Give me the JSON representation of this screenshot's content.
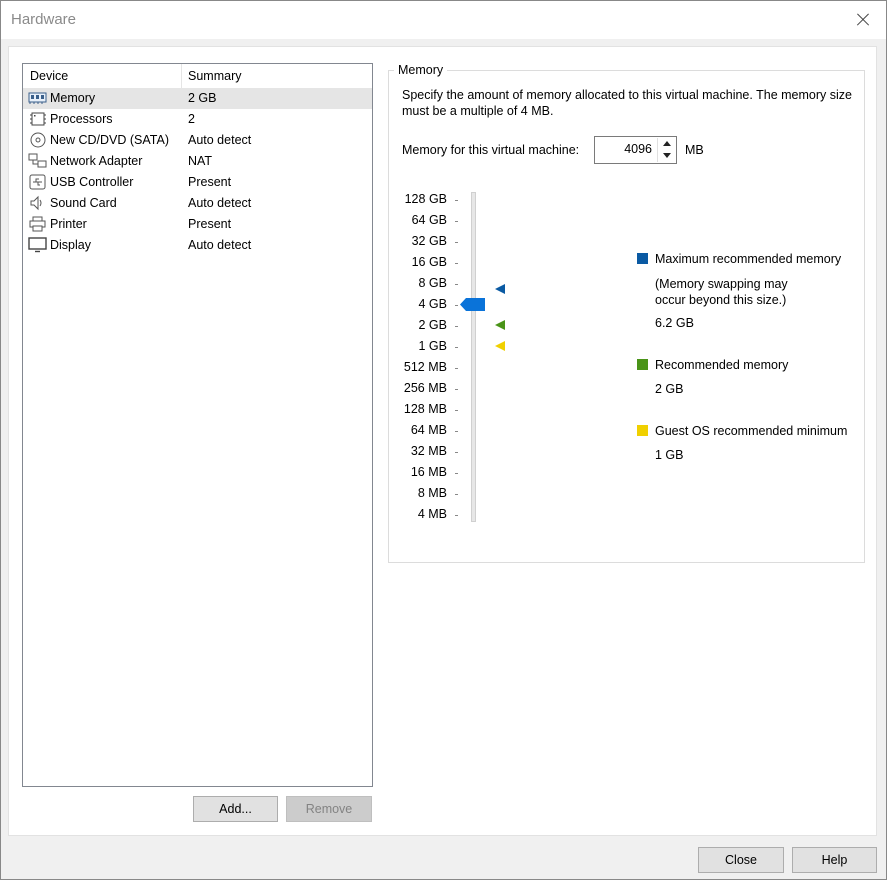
{
  "window": {
    "title": "Hardware"
  },
  "device_list": {
    "columns": {
      "device": "Device",
      "summary": "Summary"
    },
    "items": [
      {
        "name": "Memory",
        "summary": "2 GB",
        "icon": "memory-icon",
        "selected": true
      },
      {
        "name": "Processors",
        "summary": "2",
        "icon": "processor-icon"
      },
      {
        "name": "New CD/DVD (SATA)",
        "summary": "Auto detect",
        "icon": "cd-dvd-icon"
      },
      {
        "name": "Network Adapter",
        "summary": "NAT",
        "icon": "network-icon"
      },
      {
        "name": "USB Controller",
        "summary": "Present",
        "icon": "usb-icon"
      },
      {
        "name": "Sound Card",
        "summary": "Auto detect",
        "icon": "speaker-icon"
      },
      {
        "name": "Printer",
        "summary": "Present",
        "icon": "printer-icon"
      },
      {
        "name": "Display",
        "summary": "Auto detect",
        "icon": "monitor-icon"
      }
    ],
    "add_label": "Add...",
    "remove_label": "Remove"
  },
  "memory": {
    "group_title": "Memory",
    "description": "Specify the amount of memory allocated to this virtual machine. The memory size must be a multiple of 4 MB.",
    "field_label": "Memory for this virtual machine:",
    "value": "4096",
    "unit": "MB",
    "scale": [
      "128 GB",
      "64 GB",
      "32 GB",
      "16 GB",
      "8 GB",
      "4 GB",
      "2 GB",
      "1 GB",
      "512 MB",
      "256 MB",
      "128 MB",
      "64 MB",
      "32 MB",
      "16 MB",
      "8 MB",
      "4 MB"
    ],
    "legend": {
      "max": {
        "label": "Maximum recommended memory",
        "note": "(Memory swapping may occur beyond this size.)",
        "value": "6.2 GB",
        "color": "#0a5aa3"
      },
      "recommended": {
        "label": "Recommended memory",
        "value": "2 GB",
        "color": "#4a9418"
      },
      "min": {
        "label": "Guest OS recommended minimum",
        "value": "1 GB",
        "color": "#f0d000"
      }
    },
    "slider_color": "#0a73d9"
  },
  "footer": {
    "close_label": "Close",
    "help_label": "Help"
  }
}
